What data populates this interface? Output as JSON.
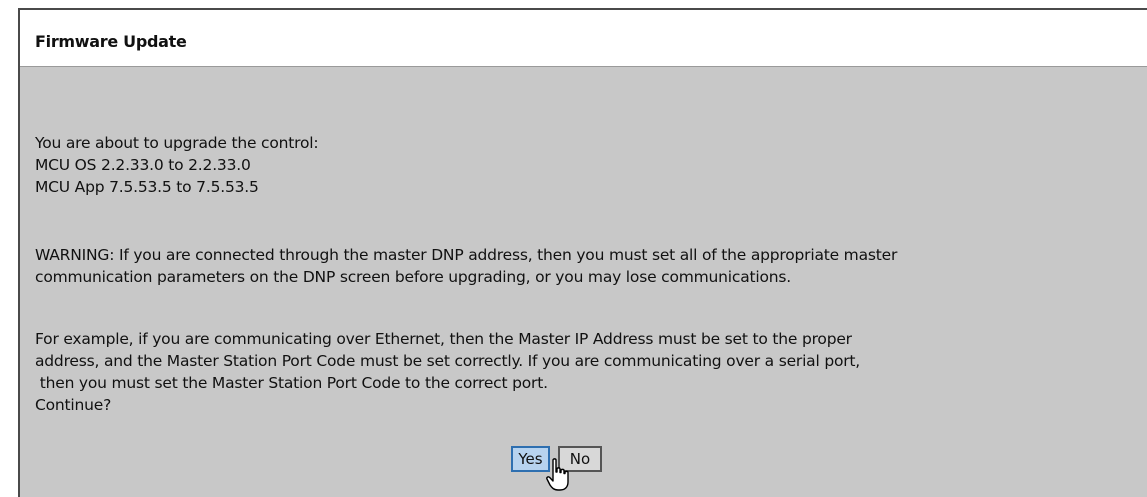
{
  "dialog": {
    "title": "Firmware Update",
    "intro_lines": [
      "You are about to upgrade the control:",
      "MCU OS 2.2.33.0 to 2.2.33.0",
      "MCU App 7.5.53.5 to 7.5.53.5"
    ],
    "warning_lines": [
      "WARNING: If you are connected through the master DNP address, then you must set all of the appropriate master",
      "communication parameters on the DNP screen before upgrading, or you may lose communications."
    ],
    "example_lines": [
      "For example, if you are communicating over Ethernet, then the Master IP Address must be set to the proper",
      "address, and the Master Station Port Code must be set correctly. If you are communicating over a serial port,",
      " then you must set the Master Station Port Code to the correct port.",
      "Continue?"
    ],
    "yes_label": "Yes",
    "no_label": "No"
  },
  "icons": {
    "cursor": "hand-pointer-icon"
  }
}
